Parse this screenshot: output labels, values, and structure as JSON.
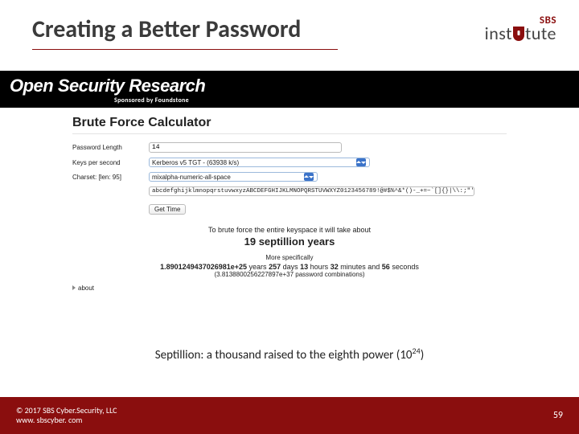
{
  "slide": {
    "title": "Creating a Better Password"
  },
  "logo": {
    "sbs": "SBS",
    "inst_pre": "inst",
    "inst_post": "tute"
  },
  "osr": {
    "title": "Open Security Research",
    "sponsor": "Sponsored by Foundstone"
  },
  "calc": {
    "heading": "Brute Force Calculator",
    "labels": {
      "pwlen": "Password Length",
      "keys": "Keys per second",
      "charset": "Charset: [len: 95]"
    },
    "pwlen_value": "14",
    "keys_value": "Kerberos v5 TGT - (63938 k/s)",
    "charset_sel": "mixalpha-numeric-all-space",
    "charset_value": "abcdefghijklmnopqrstuvwxyzABCDEFGHIJKLMNOPQRSTUVWXYZ0123456789!@#$%^&*()-_+=~`[]{}|\\\\:;\"'<>,.?/",
    "button": "Get Time",
    "result_intro": "To brute force the entire keyspace it will take about",
    "result_bold": "19 septillion years",
    "more_spec": "More specifically",
    "spec_years": "1.8901249437026981e+25",
    "spec_years_word": "years",
    "spec_days": "257",
    "spec_days_word": "days",
    "spec_hours": "13",
    "spec_hours_word": "hours",
    "spec_mins": "32",
    "spec_mins_word": "minutes and",
    "spec_secs": "56",
    "spec_secs_word": "seconds",
    "combos": "(3.8138800256227897e+37 password combinations)",
    "about": "about"
  },
  "definition": {
    "text_pre": "Septillion: a thousand raised to the eighth power (10",
    "exp": "24",
    "text_post": ")"
  },
  "footer": {
    "copyright": "© 2017 SBS Cyber.Security, LLC",
    "url": "www. sbscyber. com",
    "page": "59"
  }
}
